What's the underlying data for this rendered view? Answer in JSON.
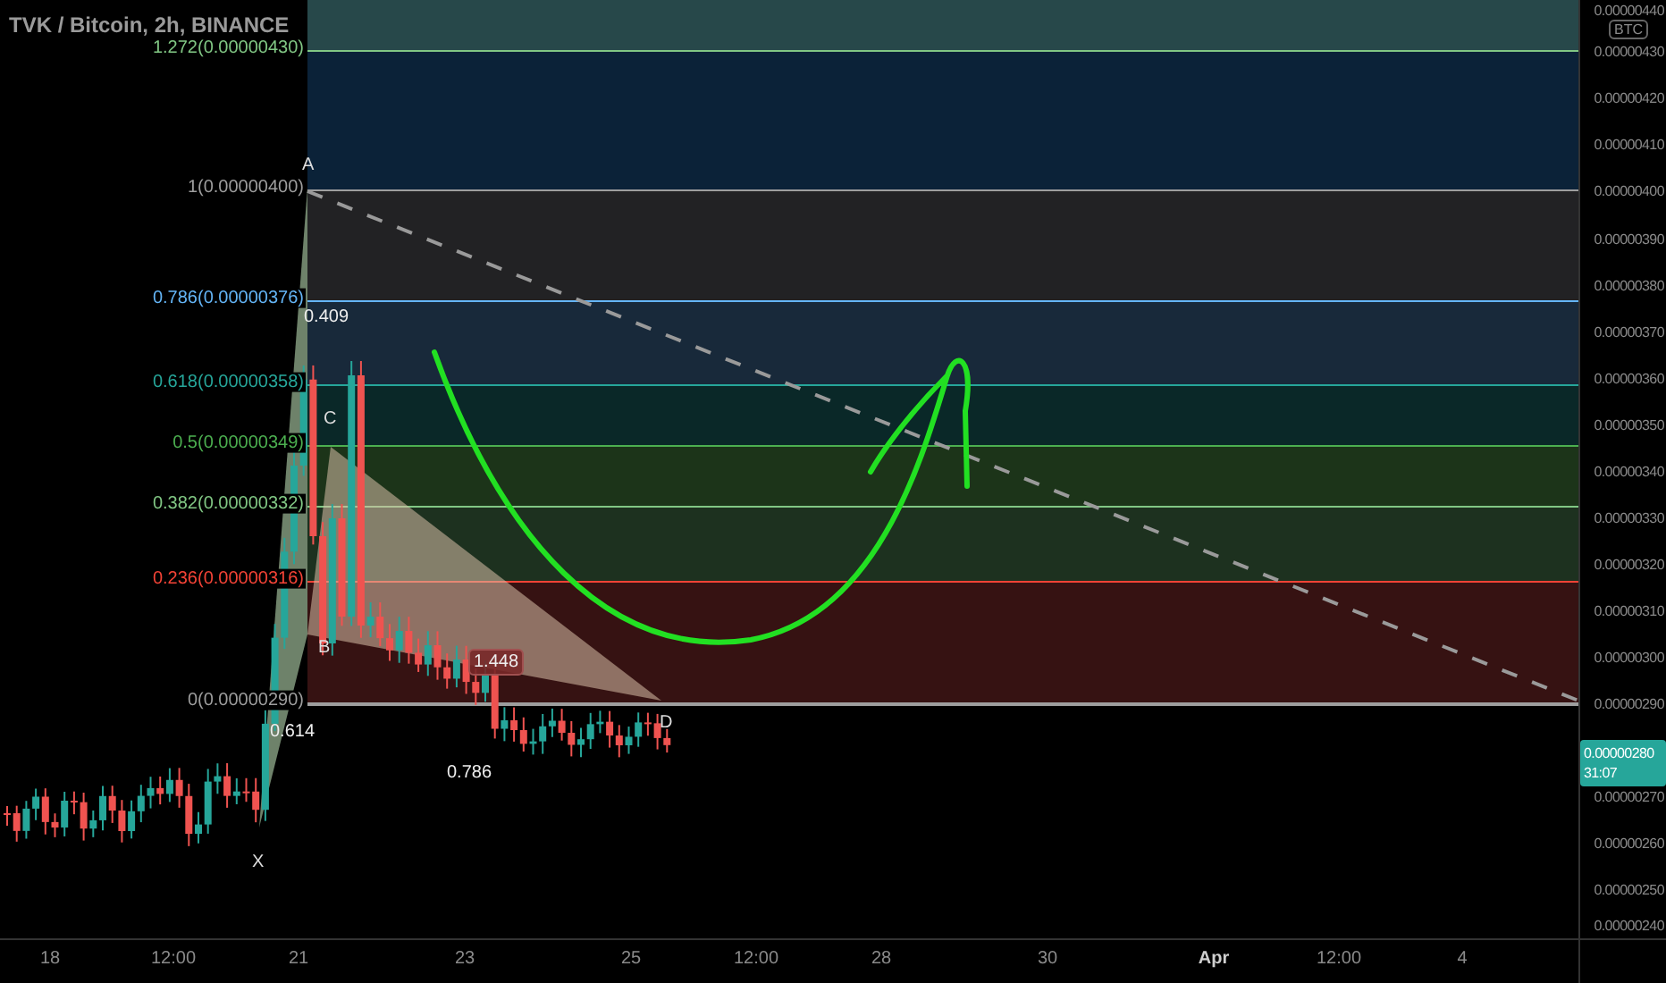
{
  "chart": {
    "title": "TVK / Bitcoin, 2h, BINANCE",
    "fib_levels": [
      {
        "label": "1.272(0.00000430)",
        "color": "#81c784"
      },
      {
        "label": "1(0.00000400)",
        "color": "#9e9e9e"
      },
      {
        "label": "0.786(0.00000376)",
        "color": "#64b5f6"
      },
      {
        "label": "0.618(0.00000358)",
        "color": "#26a69a"
      },
      {
        "label": "0.5(0.00000349)",
        "color": "#4caf50"
      },
      {
        "label": "0.382(0.00000332)",
        "color": "#81c784"
      },
      {
        "label": "0.236(0.00000316)",
        "color": "#f44336"
      },
      {
        "label": "0(0.00000290)",
        "color": "#9e9e9e"
      }
    ],
    "pattern_points": [
      "X",
      "A",
      "B",
      "C",
      "D"
    ],
    "ratios": [
      {
        "label": "0.409",
        "boxed": false
      },
      {
        "label": "0.614",
        "boxed": false
      },
      {
        "label": "1.448",
        "boxed": true
      },
      {
        "label": "0.786",
        "boxed": false
      }
    ]
  },
  "price_axis": {
    "currency": "BTC",
    "ticks": [
      "0.00000440",
      "0.00000430",
      "0.00000420",
      "0.00000410",
      "0.00000400",
      "0.00000390",
      "0.00000380",
      "0.00000370",
      "0.00000360",
      "0.00000350",
      "0.00000340",
      "0.00000330",
      "0.00000320",
      "0.00000310",
      "0.00000300",
      "0.00000290",
      "0.00000270",
      "0.00000260",
      "0.00000250",
      "0.00000240"
    ],
    "current_price": {
      "price": "0.00000280",
      "countdown": "31:07"
    }
  },
  "time_axis": [
    {
      "label": "18",
      "major": false
    },
    {
      "label": "12:00",
      "major": false
    },
    {
      "label": "21",
      "major": false
    },
    {
      "label": "23",
      "major": false
    },
    {
      "label": "25",
      "major": false
    },
    {
      "label": "12:00",
      "major": false
    },
    {
      "label": "28",
      "major": false
    },
    {
      "label": "30",
      "major": false
    },
    {
      "label": "Apr",
      "major": true
    },
    {
      "label": "12:00",
      "major": false
    },
    {
      "label": "4",
      "major": false
    }
  ]
}
